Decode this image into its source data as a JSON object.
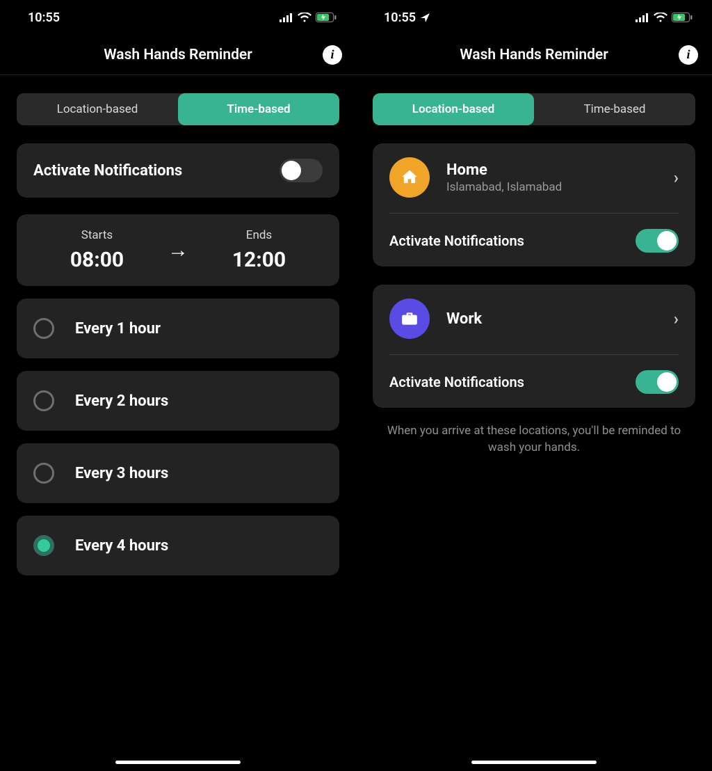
{
  "left": {
    "status": {
      "time": "10:55",
      "show_location_arrow": false
    },
    "header": {
      "title": "Wash Hands Reminder"
    },
    "tabs": {
      "location": "Location-based",
      "time": "Time-based",
      "active": "time"
    },
    "activate": {
      "label": "Activate Notifications",
      "on": false
    },
    "schedule": {
      "start_label": "Starts",
      "start_value": "08:00",
      "end_label": "Ends",
      "end_value": "12:00"
    },
    "options": [
      {
        "label": "Every 1 hour",
        "selected": false
      },
      {
        "label": "Every 2 hours",
        "selected": false
      },
      {
        "label": "Every 3 hours",
        "selected": false
      },
      {
        "label": "Every 4 hours",
        "selected": true
      }
    ]
  },
  "right": {
    "status": {
      "time": "10:55",
      "show_location_arrow": true
    },
    "header": {
      "title": "Wash Hands Reminder"
    },
    "tabs": {
      "location": "Location-based",
      "time": "Time-based",
      "active": "location"
    },
    "locations": [
      {
        "name": "Home",
        "subtitle": "Islamabad, Islamabad",
        "icon": "home",
        "activate_label": "Activate Notifications",
        "on": true
      },
      {
        "name": "Work",
        "subtitle": "",
        "icon": "work",
        "activate_label": "Activate Notifications",
        "on": true
      }
    ],
    "footer": "When you arrive at these locations, you'll be reminded to wash your hands."
  }
}
